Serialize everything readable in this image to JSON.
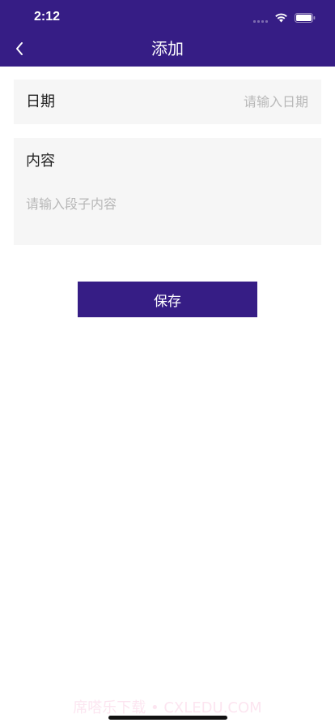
{
  "colors": {
    "primary": "#361d85",
    "card_bg": "#f6f6f6",
    "placeholder": "#b8b8b8",
    "text": "#222222"
  },
  "status_bar": {
    "time": "2:12",
    "icons": [
      "cellular-signal-icon",
      "wifi-icon",
      "battery-icon"
    ]
  },
  "nav": {
    "back_icon": "chevron-left-icon",
    "title": "添加"
  },
  "form": {
    "date": {
      "label": "日期",
      "value": "",
      "placeholder": "请输入日期"
    },
    "content": {
      "label": "内容",
      "value": "",
      "placeholder": "请输入段子内容"
    },
    "save_label": "保存"
  },
  "watermark": "席嗒乐下载 • CXLEDU.COM"
}
